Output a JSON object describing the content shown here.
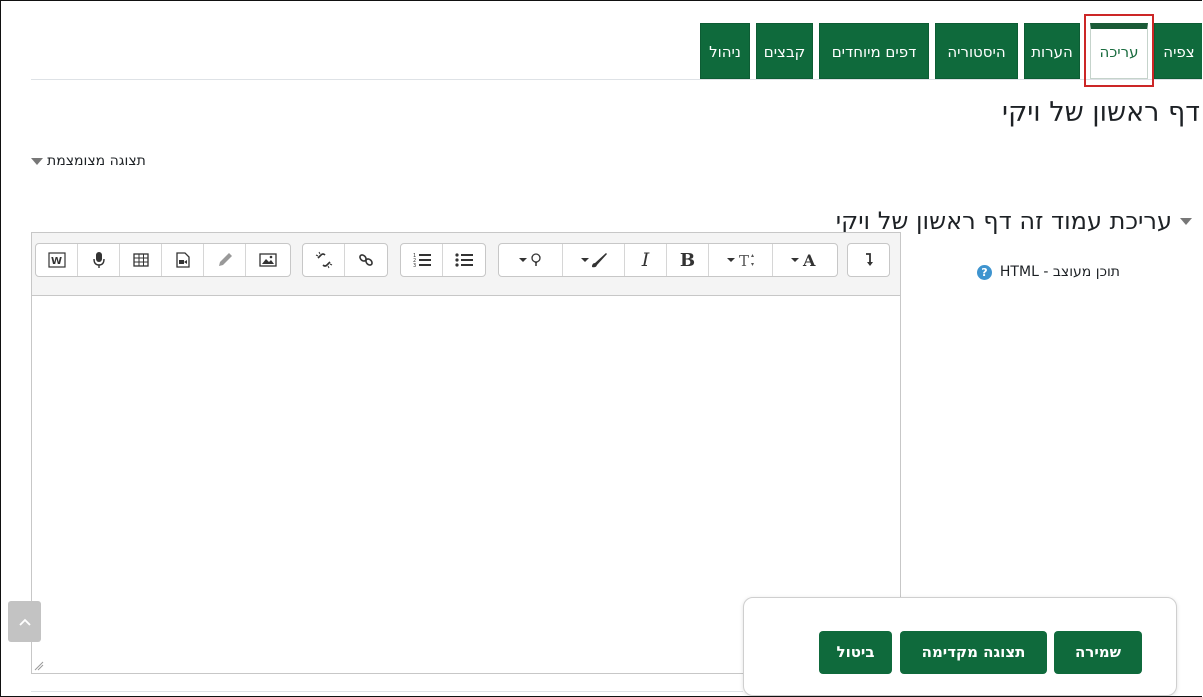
{
  "tabs": [
    {
      "label": "צפיה",
      "active": false
    },
    {
      "label": "עריכה",
      "active": true
    },
    {
      "label": "הערות",
      "active": false
    },
    {
      "label": "היסטוריה",
      "active": false
    },
    {
      "label": "דפים מיוחדים",
      "active": false
    },
    {
      "label": "קבצים",
      "active": false
    },
    {
      "label": "ניהול",
      "active": false
    }
  ],
  "page": {
    "title": "דף ראשון של ויקי",
    "collapse_label": "תצוגה מצומצמת",
    "section_title": "עריכת עמוד זה דף ראשון של ויקי"
  },
  "editor": {
    "field_label": "תוכן מעוצב - HTML",
    "content": "",
    "toolbar": [
      "word-paste-icon",
      "microphone-icon",
      "table-icon",
      "media-icon",
      "draw-icon",
      "image-icon",
      "unlink-icon",
      "link-icon",
      "numbered-list-icon",
      "bullet-list-icon",
      "emoji-icon",
      "highlight-icon",
      "italic-icon",
      "bold-icon",
      "font-size-icon",
      "font-color-icon",
      "rtl-direction-icon"
    ]
  },
  "actions": {
    "save": "שמירה",
    "preview": "תצוגה מקדימה",
    "cancel": "ביטול"
  },
  "colors": {
    "brand": "#0f6a3c",
    "highlight_box": "#cc2626"
  }
}
